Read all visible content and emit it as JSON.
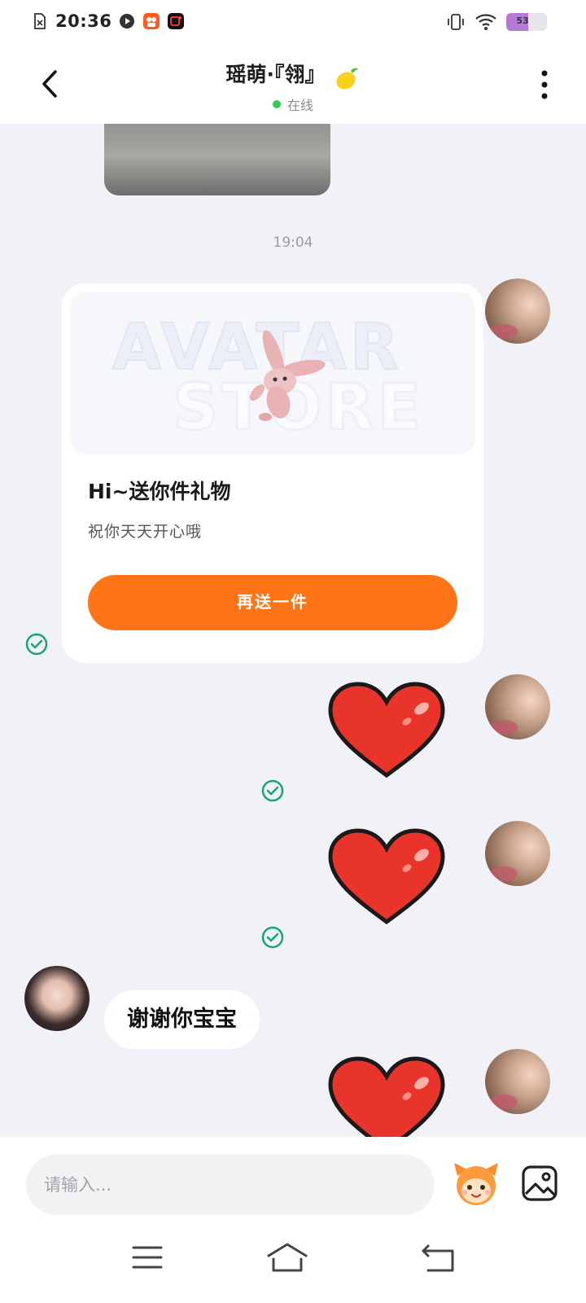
{
  "status_bar": {
    "time": "20:36",
    "battery": "53",
    "battery_level": 0.53
  },
  "header": {
    "title": "瑶萌·『翎』",
    "online_text": "在线"
  },
  "chat": {
    "time_separator": "19:04",
    "gift_card": {
      "banner_line1": "AVATAR",
      "banner_line2": "STORE",
      "title": "Hi~送你件礼物",
      "subtitle": "祝你天天开心哦",
      "button_label": "再送一件"
    },
    "reply_text": "谢谢你宝宝"
  },
  "input": {
    "placeholder": "请输入..."
  },
  "colors": {
    "accent_orange": "#ff7417",
    "online_green": "#2ecc52",
    "check_teal": "#1aa37a",
    "heart_red": "#e8342a"
  }
}
